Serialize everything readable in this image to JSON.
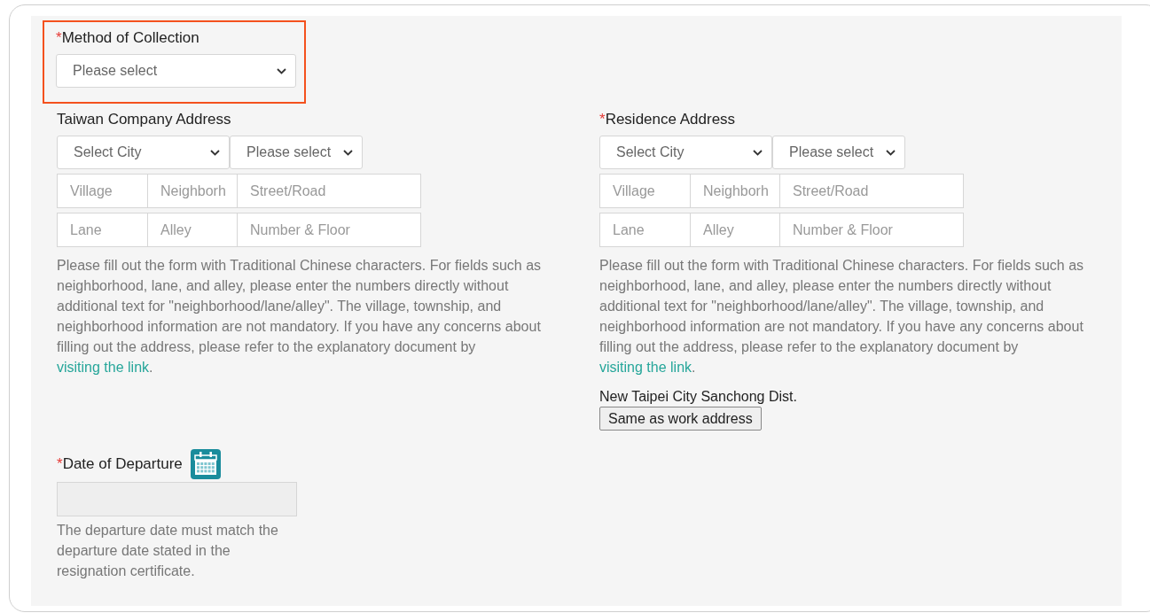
{
  "collection": {
    "required_marker": "*",
    "label": "Method of Collection",
    "highlighted": true,
    "placeholder": "Please select"
  },
  "addresses": [
    {
      "label": "Taiwan Company Address",
      "city_select": "Select City",
      "district_select": "Please select",
      "fields": [
        {
          "placeholder": "Village"
        },
        {
          "placeholder": "Neighborh"
        },
        {
          "placeholder": "Street/Road"
        },
        {
          "placeholder": "Lane"
        },
        {
          "placeholder": "Alley"
        },
        {
          "placeholder": "Number & Floor"
        }
      ],
      "note": "Please fill out the form with Traditional Chinese characters. For fields such as neighborhood, lane, and alley, please enter the numbers directly without additional text for \"neighborhood/lane/alley\". The village, township, and neighborhood information are not mandatory. If you have any concerns about filling out the address, please refer to the explanatory document by",
      "link": "visiting the link",
      "note_end": "."
    },
    {
      "required_marker": "*",
      "label": "Residence Address",
      "city_select": "Select City",
      "district_select": "Please select",
      "fields": [
        {
          "placeholder": "Village"
        },
        {
          "placeholder": "Neighborh"
        },
        {
          "placeholder": "Street/Road"
        },
        {
          "placeholder": "Lane"
        },
        {
          "placeholder": "Alley"
        },
        {
          "placeholder": "Number & Floor"
        }
      ],
      "note": "Please fill out the form with Traditional Chinese characters. For fields such as neighborhood, lane, and alley, please enter the numbers directly without additional text for \"neighborhood/lane/alley\". The village, township, and neighborhood information are not mandatory. If you have any concerns about filling out the address, please refer to the explanatory document by",
      "link": "visiting the link",
      "note_end": ".",
      "work_address": "New Taipei City Sanchong Dist.",
      "copy_button": "Same as work address"
    }
  ],
  "departure": {
    "required_marker": "*",
    "label": "Date of Departure",
    "disabled": true,
    "help": "The departure date must match the departure date stated in the resignation certificate."
  }
}
